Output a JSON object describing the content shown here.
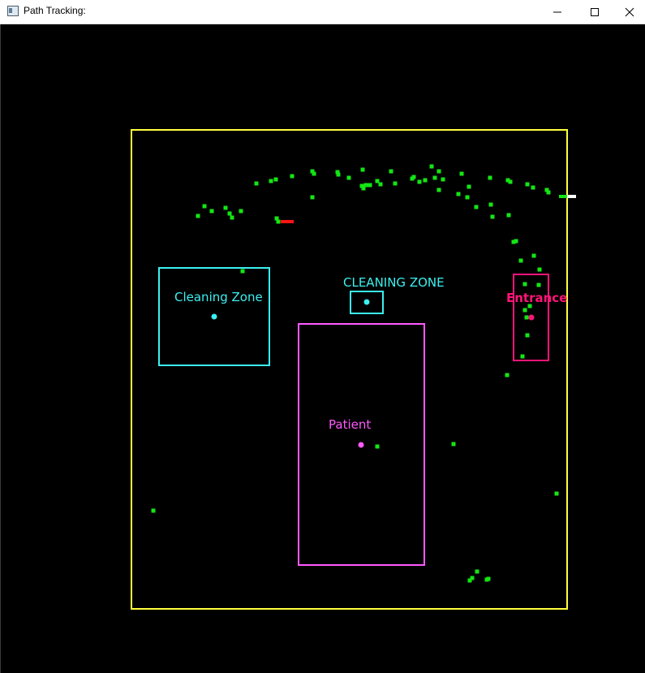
{
  "window": {
    "title": "Path Tracking:",
    "controls": {
      "minimize_icon": "minimize-icon",
      "maximize_icon": "maximize-icon",
      "close_icon": "close-icon"
    }
  },
  "map": {
    "background_color": "#000000",
    "colors": {
      "room_border": "#ffff3c",
      "cleaning_zone": "#3cf0f0",
      "patient": "#ff5aff",
      "entrance": "#ff1478",
      "path_point": "#14e614",
      "robot_marker": "#ff1414",
      "sensor_marker": "#ffffff"
    },
    "labels": {
      "cleaning_zone_left": "Cleaning Zone",
      "cleaning_zone_center": "CLEANING ZONE",
      "patient": "Patient",
      "entrance": "Entrance"
    }
  }
}
